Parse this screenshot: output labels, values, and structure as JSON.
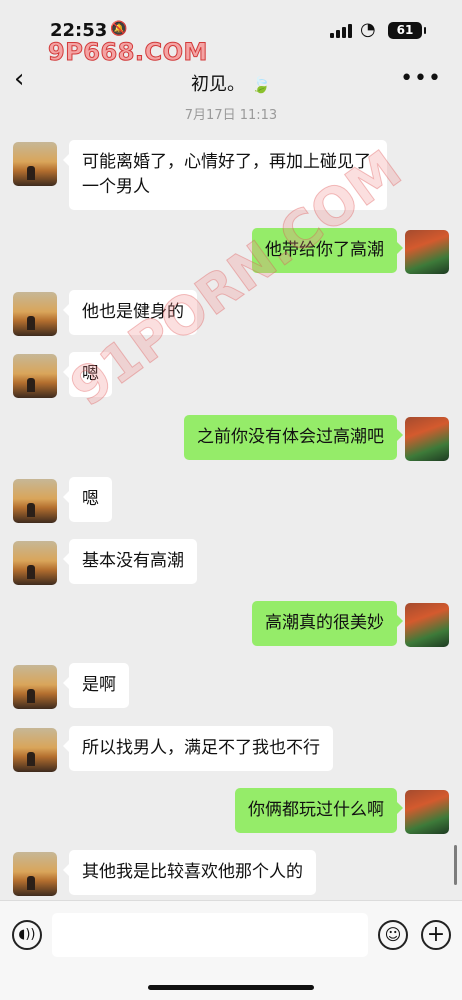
{
  "status_bar": {
    "time": "22:53",
    "battery": "61"
  },
  "watermark": {
    "top": "9P668.COM",
    "diagonal": "91PORN.COM"
  },
  "header": {
    "title": "初见。"
  },
  "timestamp": "7月17日 11:13",
  "messages": [
    {
      "side": "left",
      "text": "可能离婚了，心情好了，再加上碰见了一个男人"
    },
    {
      "side": "right",
      "text": "他带给你了高潮"
    },
    {
      "side": "left",
      "text": "他也是健身的"
    },
    {
      "side": "left",
      "text": "嗯"
    },
    {
      "side": "right",
      "text": "之前你没有体会过高潮吧"
    },
    {
      "side": "left",
      "text": "嗯"
    },
    {
      "side": "left",
      "text": "基本没有高潮"
    },
    {
      "side": "right",
      "text": "高潮真的很美妙"
    },
    {
      "side": "left",
      "text": "是啊"
    },
    {
      "side": "left",
      "text": "所以找男人，满足不了我也不行"
    },
    {
      "side": "right",
      "text": "你俩都玩过什么啊"
    },
    {
      "side": "left",
      "text": "其他我是比较喜欢他那个人的"
    }
  ],
  "colors": {
    "accent": "#95ec69",
    "background": "#ededed",
    "bubble_left": "#ffffff"
  }
}
